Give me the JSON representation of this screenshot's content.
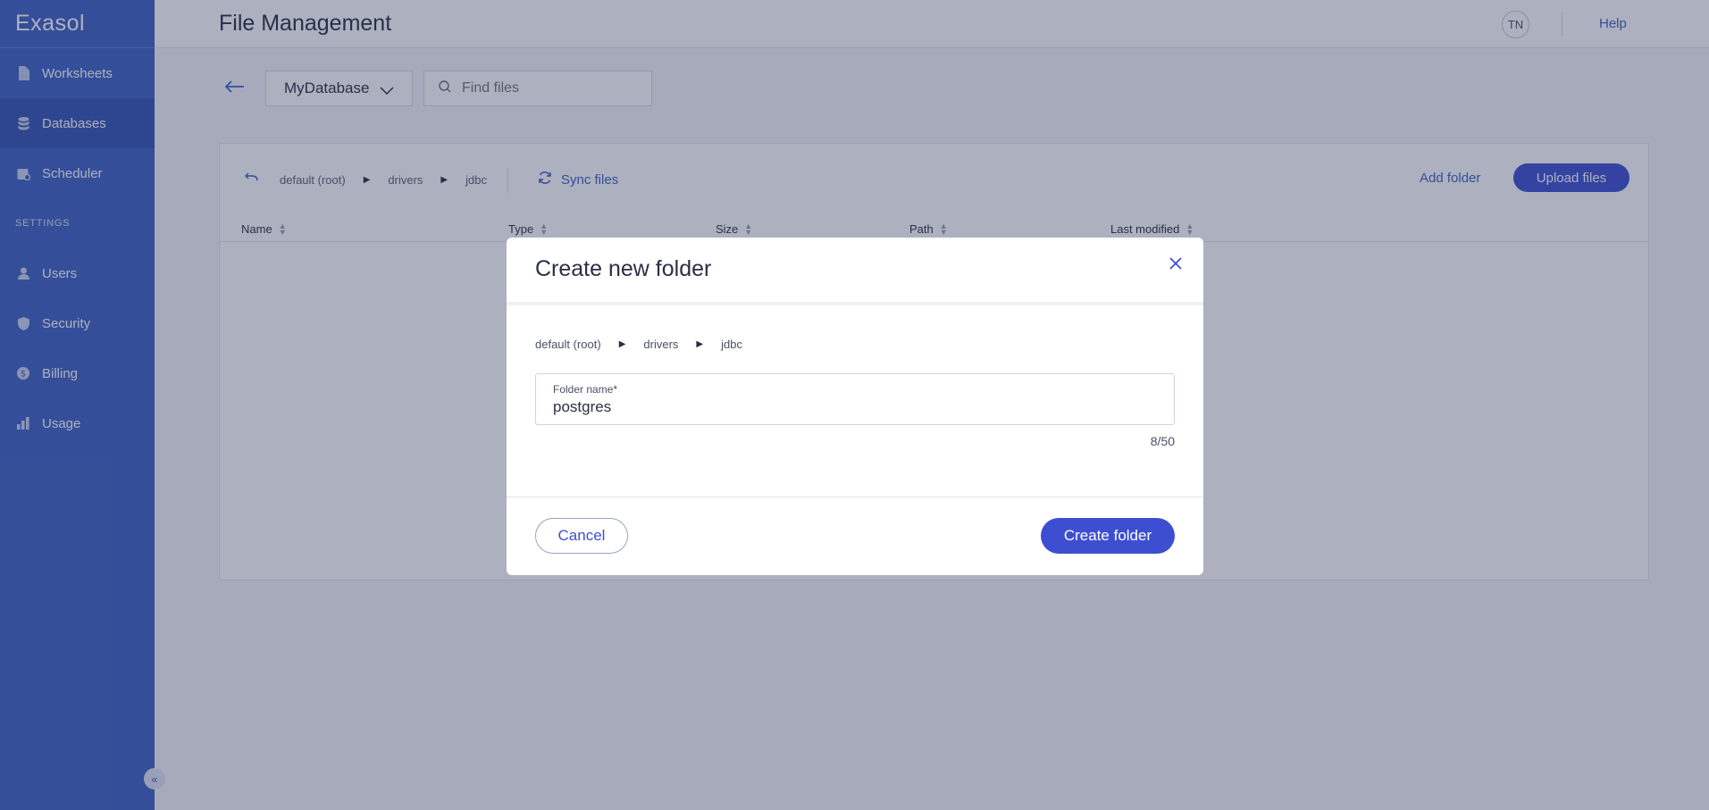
{
  "app": {
    "logo": "Exasol",
    "page_title": "File Management",
    "avatar_initials": "TN",
    "help_label": "Help"
  },
  "sidebar": {
    "items": [
      {
        "label": "Worksheets",
        "icon": "document-icon"
      },
      {
        "label": "Databases",
        "icon": "database-icon"
      },
      {
        "label": "Scheduler",
        "icon": "calendar-icon"
      }
    ],
    "section_label": "SETTINGS",
    "settings_items": [
      {
        "label": "Users",
        "icon": "user-icon"
      },
      {
        "label": "Security",
        "icon": "shield-icon"
      },
      {
        "label": "Billing",
        "icon": "dollar-icon"
      },
      {
        "label": "Usage",
        "icon": "bar-chart-icon"
      }
    ]
  },
  "toolbar": {
    "database_value": "MyDatabase",
    "search_placeholder": "Find files"
  },
  "files": {
    "breadcrumb": [
      "default (root)",
      "drivers",
      "jdbc"
    ],
    "sync_label": "Sync files",
    "add_folder_label": "Add folder",
    "upload_label": "Upload files",
    "columns": [
      "Name",
      "Type",
      "Size",
      "Path",
      "Last modified"
    ]
  },
  "modal": {
    "title": "Create new folder",
    "breadcrumb": [
      "default (root)",
      "drivers",
      "jdbc"
    ],
    "field_label": "Folder name*",
    "field_value": "postgres",
    "counter": "8/50",
    "cancel_label": "Cancel",
    "create_label": "Create folder"
  },
  "colors": {
    "sidebar": "#3d62c4",
    "accent": "#3d4fd0"
  }
}
